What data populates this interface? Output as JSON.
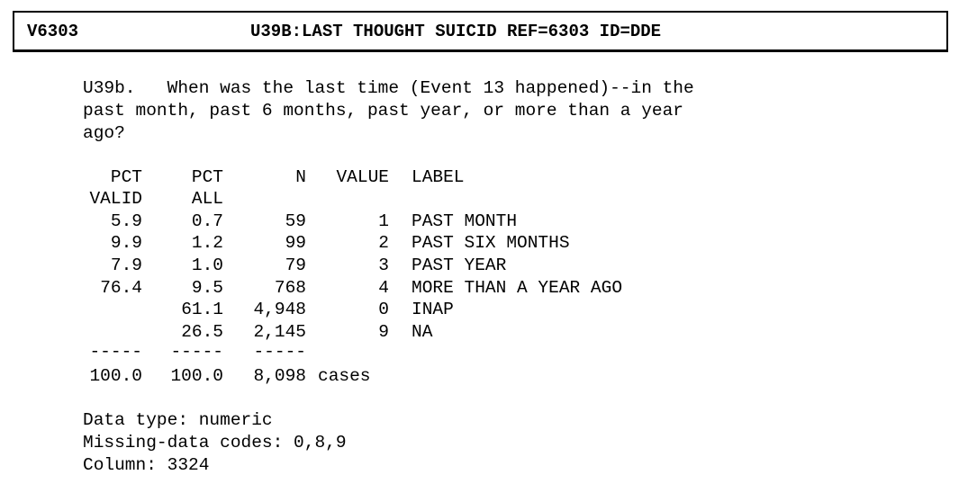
{
  "header": {
    "variable_id": "V6303",
    "variable_title": "U39B:LAST THOUGHT SUICID REF=6303 ID=DDE"
  },
  "question": {
    "lines": [
      "U39b.   When was the last time (Event 13 happened)--in the",
      "past month, past 6 months, past year, or more than a year",
      "ago?"
    ]
  },
  "table": {
    "headers_row1": {
      "pct_valid": "PCT",
      "pct_all": "PCT",
      "n": "N",
      "value": "VALUE",
      "label": "LABEL"
    },
    "headers_row2": {
      "pct_valid": "VALID",
      "pct_all": "ALL"
    },
    "rows": [
      {
        "pct_valid": "5.9",
        "pct_all": "0.7",
        "n": "59",
        "value": "1",
        "label": "PAST MONTH"
      },
      {
        "pct_valid": "9.9",
        "pct_all": "1.2",
        "n": "99",
        "value": "2",
        "label": "PAST SIX MONTHS"
      },
      {
        "pct_valid": "7.9",
        "pct_all": "1.0",
        "n": "79",
        "value": "3",
        "label": "PAST YEAR"
      },
      {
        "pct_valid": "76.4",
        "pct_all": "9.5",
        "n": "768",
        "value": "4",
        "label": "MORE THAN A YEAR AGO"
      },
      {
        "pct_valid": "",
        "pct_all": "61.1",
        "n": "4,948",
        "value": "0",
        "label": "INAP"
      },
      {
        "pct_valid": "",
        "pct_all": "26.5",
        "n": "2,145",
        "value": "9",
        "label": "NA"
      }
    ],
    "separator": {
      "pct_valid": "-----",
      "pct_all": "-----",
      "n": "-----"
    },
    "totals": {
      "pct_valid": "100.0",
      "pct_all": "100.0",
      "n": "8,098",
      "suffix": "cases"
    }
  },
  "footer": {
    "data_type": "Data type: numeric",
    "missing_codes": "Missing-data codes: 0,8,9",
    "column": "Column: 3324"
  }
}
